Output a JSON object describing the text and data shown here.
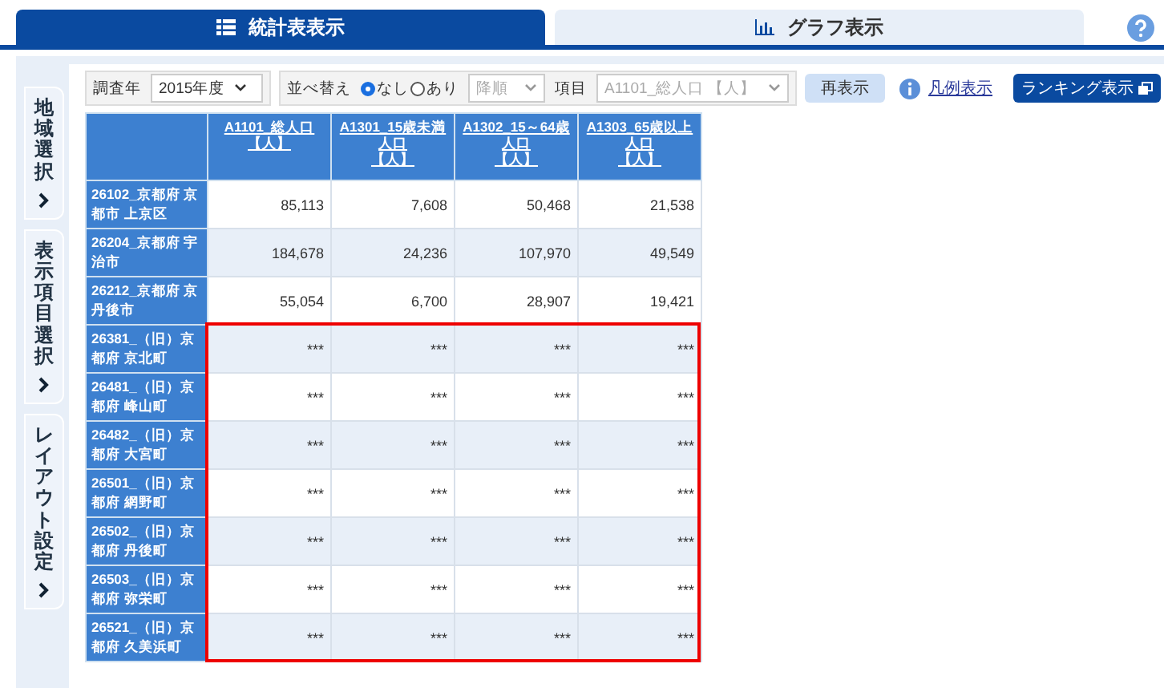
{
  "tabs": [
    {
      "label": "統計表表示",
      "selected": true
    },
    {
      "label": "グラフ表示",
      "selected": false
    }
  ],
  "side_tabs": [
    {
      "label": "地域選択"
    },
    {
      "label": "表示項目選択"
    },
    {
      "label": "レイアウト設定"
    }
  ],
  "toolbar": {
    "year_label": "調査年",
    "year_value": "2015年度",
    "sort_label": "並べ替え",
    "sort_options": [
      {
        "label": "なし",
        "selected": true
      },
      {
        "label": "あり",
        "selected": false
      }
    ],
    "order_value": "降順",
    "order_disabled": true,
    "item_label": "項目",
    "item_value": "A1101_総人口 【人】",
    "item_disabled": true,
    "refresh_button": "再表示",
    "legend_link": "凡例表示",
    "ranking_button": "ランキング表示"
  },
  "table": {
    "columns": [
      {
        "code": "A1101_総人口",
        "unit": "【人】"
      },
      {
        "code": "A1301_15歳未満人口",
        "unit": "【人】"
      },
      {
        "code": "A1302_15～64歳人口",
        "unit": "【人】"
      },
      {
        "code": "A1303_65歳以上人口",
        "unit": "【人】"
      }
    ],
    "rows": [
      {
        "name": "26102_京都府 京都市 上京区",
        "values": [
          "85,113",
          "7,608",
          "50,468",
          "21,538"
        ],
        "highlighted": false
      },
      {
        "name": "26204_京都府 宇治市",
        "values": [
          "184,678",
          "24,236",
          "107,970",
          "49,549"
        ],
        "highlighted": false
      },
      {
        "name": "26212_京都府 京丹後市",
        "values": [
          "55,054",
          "6,700",
          "28,907",
          "19,421"
        ],
        "highlighted": false
      },
      {
        "name": "26381_（旧）京都府 京北町",
        "values": [
          "***",
          "***",
          "***",
          "***"
        ],
        "highlighted": true
      },
      {
        "name": "26481_（旧）京都府 峰山町",
        "values": [
          "***",
          "***",
          "***",
          "***"
        ],
        "highlighted": true
      },
      {
        "name": "26482_（旧）京都府 大宮町",
        "values": [
          "***",
          "***",
          "***",
          "***"
        ],
        "highlighted": true
      },
      {
        "name": "26501_（旧）京都府 網野町",
        "values": [
          "***",
          "***",
          "***",
          "***"
        ],
        "highlighted": true
      },
      {
        "name": "26502_（旧）京都府 丹後町",
        "values": [
          "***",
          "***",
          "***",
          "***"
        ],
        "highlighted": true
      },
      {
        "name": "26503_（旧）京都府 弥栄町",
        "values": [
          "***",
          "***",
          "***",
          "***"
        ],
        "highlighted": true
      },
      {
        "name": "26521_（旧）京都府 久美浜町",
        "values": [
          "***",
          "***",
          "***",
          "***"
        ],
        "highlighted": true
      }
    ]
  }
}
